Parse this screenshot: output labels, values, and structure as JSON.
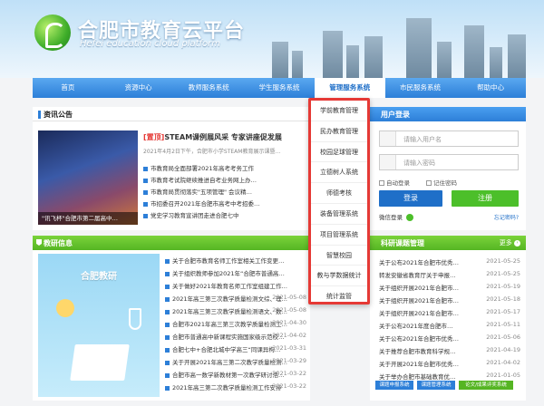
{
  "header": {
    "title": "合肥市教育云平台",
    "subtitle": "Hefei education cloud platform"
  },
  "nav": {
    "items": [
      "首页",
      "资源中心",
      "教师服务系统",
      "学生服务系统",
      "管理服务系统",
      "市民服务系统",
      "帮助中心"
    ],
    "active_index": 4
  },
  "dropdown": {
    "items": [
      "学前教育管理",
      "民办教育管理",
      "校园足球管理",
      "立德树人系统",
      "师德考核",
      "装备管理系统",
      "项目管理系统",
      "智慧校园",
      "教与学数据统计",
      "统计监管"
    ]
  },
  "news": {
    "heading": "资讯公告",
    "featured_tag": "[置顶]",
    "featured_title": "STEAM课例展风采 专家讲座促发展",
    "featured_summary": "2021年4月2日下午，合肥市小学STEAM教育展示课暨…",
    "image_caption": "\"讯飞杯\"合肥市第二届高中…",
    "items": [
      "市教育局全面部署2021年高考考务工作",
      "市教育考试院继续推进自考业务网上办…",
      "市教育局贯彻落实\"五项管理\" 会议精…",
      "市招委召开2021年合肥市高考中考招委…",
      "党史学习教育宣讲团走进合肥七中"
    ]
  },
  "research": {
    "heading": "教研信息",
    "image_title": "合肥教研",
    "items": [
      {
        "text": "关于合肥市教育名师工作室相关工作变更…",
        "date": ""
      },
      {
        "text": "关于组织教师参加2021年“合肥市普通高…",
        "date": ""
      },
      {
        "text": "关于做好2021年教育名师工作室组建工作…",
        "date": ""
      },
      {
        "text": "2021年高三第三次教学质量检测文综、理…",
        "date": "2021-05-08"
      },
      {
        "text": "2021年高三第三次教学质量检测语文、数…",
        "date": "2021-05-08"
      },
      {
        "text": "合肥市2021年高三第三次教学质量检测工…",
        "date": "2021-04-30"
      },
      {
        "text": "合肥市普通高中新课程实施国家级示范校…",
        "date": "2021-04-02"
      },
      {
        "text": "合肥七中+合肥北城中学高三“同课异构…",
        "date": "2021-03-31"
      },
      {
        "text": "关于开展2021年高三第二次教学质量检测…",
        "date": "2021-03-29"
      },
      {
        "text": "合肥市高一数学新教材第一次教学研讨活…",
        "date": "2021-03-22"
      },
      {
        "text": "2021年高三第二次教学质量检测工作安排",
        "date": "2021-03-22"
      }
    ]
  },
  "login": {
    "heading": "用户登录",
    "username_placeholder": "请输入用户名",
    "password_placeholder": "请输入密码",
    "auto_login": "自动登录",
    "remember_password": "记住密码",
    "login_button": "登录",
    "register_button": "注册",
    "wechat_login": "微信登录",
    "forgot_password": "忘记密码?"
  },
  "research_mgmt": {
    "heading": "科研课题管理",
    "more": "更多",
    "items": [
      {
        "text": "关于公布2021年合肥市优秀…",
        "date": "2021-05-25"
      },
      {
        "text": "转发安徽省教育厅关于申报…",
        "date": "2021-05-25"
      },
      {
        "text": "关于组织开展2021年合肥市…",
        "date": "2021-05-19"
      },
      {
        "text": "关于组织开展2021年合肥市…",
        "date": "2021-05-18"
      },
      {
        "text": "关于组织开展2021年合肥市…",
        "date": "2021-05-17"
      },
      {
        "text": "关于公布2021年度合肥市…",
        "date": "2021-05-11"
      },
      {
        "text": "关于公布2021年合肥市优秀…",
        "date": "2021-05-06"
      },
      {
        "text": "关于推荐合肥市教育科学规…",
        "date": "2021-04-19"
      },
      {
        "text": "关于开展2021年合肥市优秀…",
        "date": "2021-04-02"
      },
      {
        "text": "关于举办合肥市基础教育优…",
        "date": "2021-01-05"
      },
      {
        "text": "关于对2016年度立项省规…",
        "date": "2020-12-31"
      }
    ],
    "tags": [
      "课题申报系统",
      "课题管理系统",
      "论文/成果评奖系统"
    ]
  },
  "colors": {
    "nav_blue": "#2d7fd8",
    "green_header": "#55b523",
    "dropdown_border": "#e53935",
    "login_btn": "#1f6fc8",
    "register_btn": "#4cbf2a"
  }
}
